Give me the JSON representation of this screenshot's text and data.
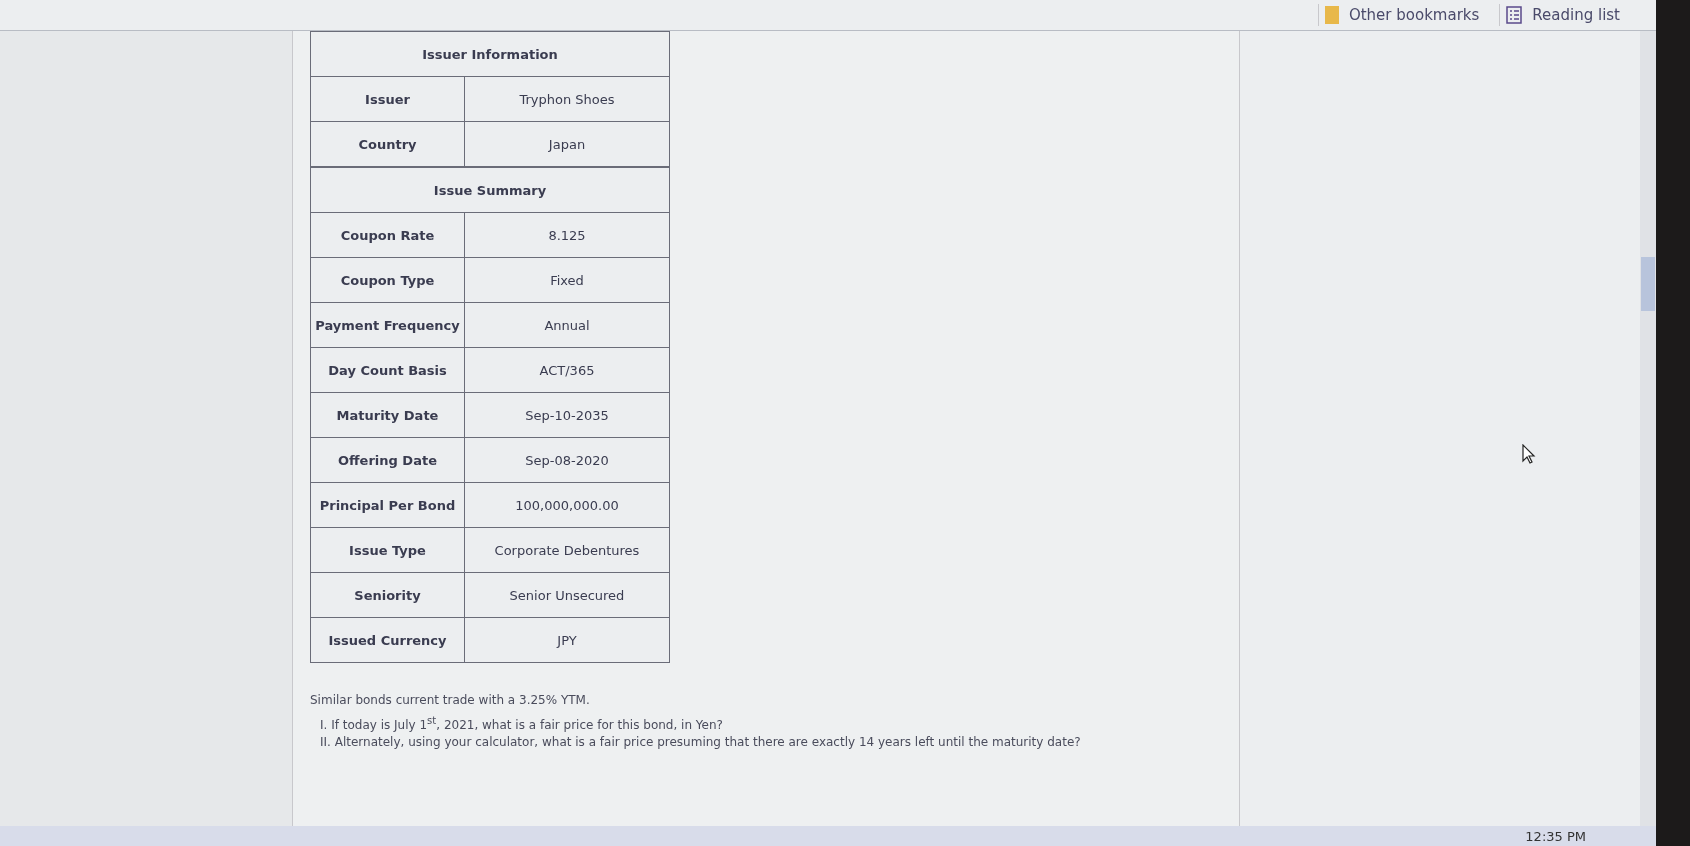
{
  "bookmarks_bar": {
    "items": [
      {
        "label": "Other bookmarks",
        "kind": "folder"
      },
      {
        "label": "Reading list",
        "kind": "list"
      }
    ]
  },
  "tables": [
    {
      "title": "Issuer Information",
      "rows": [
        {
          "label": "Issuer",
          "value": "Tryphon Shoes"
        },
        {
          "label": "Country",
          "value": "Japan"
        }
      ]
    },
    {
      "title": "Issue Summary",
      "rows": [
        {
          "label": "Coupon Rate",
          "value": "8.125"
        },
        {
          "label": "Coupon Type",
          "value": "Fixed"
        },
        {
          "label": "Payment Frequency",
          "value": "Annual"
        },
        {
          "label": "Day Count Basis",
          "value": "ACT/365"
        },
        {
          "label": "Maturity Date",
          "value": "Sep-10-2035"
        },
        {
          "label": "Offering Date",
          "value": "Sep-08-2020"
        },
        {
          "label": "Principal Per Bond",
          "value": "100,000,000.00"
        },
        {
          "label": "Issue Type",
          "value": "Corporate Debentures"
        },
        {
          "label": "Seniority",
          "value": "Senior Unsecured"
        },
        {
          "label": "Issued Currency",
          "value": "JPY"
        }
      ]
    }
  ],
  "question": {
    "intro": "Similar bonds current trade with a 3.25% YTM.",
    "items": [
      "I. If today is July 1$^{st}$, 2021, what is a fair price for this bond, in Yen?",
      "II. Alternately, using your calculator, what is a fair price presuming that there are exactly 14 years left until the maturity date?"
    ]
  },
  "taskbar": {
    "clock": "12:35 PM"
  }
}
